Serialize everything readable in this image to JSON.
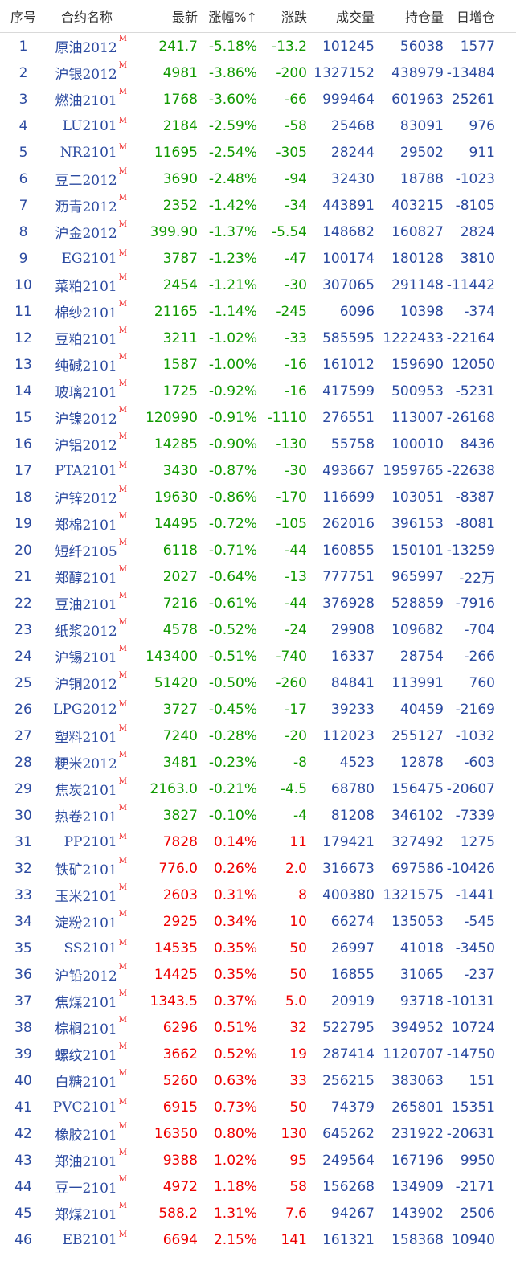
{
  "headers": [
    "序号",
    "合约名称",
    "最新",
    "涨幅%↑",
    "涨跌",
    "成交量",
    "持仓量",
    "日增仓"
  ],
  "colors": {
    "down": "#119900",
    "up": "#ee0000",
    "neutral": "#2b4aa0"
  },
  "rows": [
    {
      "no": "1",
      "name": "原油2012",
      "mark": "M",
      "last": "241.7",
      "pct": "-5.18%",
      "chg": "-13.2",
      "vol": "101245",
      "oi": "56038",
      "inc": "1577",
      "dir": "down"
    },
    {
      "no": "2",
      "name": "沪银2012",
      "mark": "M",
      "last": "4981",
      "pct": "-3.86%",
      "chg": "-200",
      "vol": "1327152",
      "oi": "438979",
      "inc": "-13484",
      "dir": "down"
    },
    {
      "no": "3",
      "name": "燃油2101",
      "mark": "M",
      "last": "1768",
      "pct": "-3.60%",
      "chg": "-66",
      "vol": "999464",
      "oi": "601963",
      "inc": "25261",
      "dir": "down"
    },
    {
      "no": "4",
      "name": "LU2101",
      "mark": "M",
      "last": "2184",
      "pct": "-2.59%",
      "chg": "-58",
      "vol": "25468",
      "oi": "83091",
      "inc": "976",
      "dir": "down"
    },
    {
      "no": "5",
      "name": "NR2101",
      "mark": "M",
      "last": "11695",
      "pct": "-2.54%",
      "chg": "-305",
      "vol": "28244",
      "oi": "29502",
      "inc": "911",
      "dir": "down"
    },
    {
      "no": "6",
      "name": "豆二2012",
      "mark": "M",
      "last": "3690",
      "pct": "-2.48%",
      "chg": "-94",
      "vol": "32430",
      "oi": "18788",
      "inc": "-1023",
      "dir": "down"
    },
    {
      "no": "7",
      "name": "沥青2012",
      "mark": "M",
      "last": "2352",
      "pct": "-1.42%",
      "chg": "-34",
      "vol": "443891",
      "oi": "403215",
      "inc": "-8105",
      "dir": "down"
    },
    {
      "no": "8",
      "name": "沪金2012",
      "mark": "M",
      "last": "399.90",
      "pct": "-1.37%",
      "chg": "-5.54",
      "vol": "148682",
      "oi": "160827",
      "inc": "2824",
      "dir": "down"
    },
    {
      "no": "9",
      "name": "EG2101",
      "mark": "M",
      "last": "3787",
      "pct": "-1.23%",
      "chg": "-47",
      "vol": "100174",
      "oi": "180128",
      "inc": "3810",
      "dir": "down"
    },
    {
      "no": "10",
      "name": "菜粕2101",
      "mark": "M",
      "last": "2454",
      "pct": "-1.21%",
      "chg": "-30",
      "vol": "307065",
      "oi": "291148",
      "inc": "-11442",
      "dir": "down"
    },
    {
      "no": "11",
      "name": "棉纱2101",
      "mark": "M",
      "last": "21165",
      "pct": "-1.14%",
      "chg": "-245",
      "vol": "6096",
      "oi": "10398",
      "inc": "-374",
      "dir": "down"
    },
    {
      "no": "12",
      "name": "豆粕2101",
      "mark": "M",
      "last": "3211",
      "pct": "-1.02%",
      "chg": "-33",
      "vol": "585595",
      "oi": "1222433",
      "inc": "-22164",
      "dir": "down"
    },
    {
      "no": "13",
      "name": "纯碱2101",
      "mark": "M",
      "last": "1587",
      "pct": "-1.00%",
      "chg": "-16",
      "vol": "161012",
      "oi": "159690",
      "inc": "12050",
      "dir": "down"
    },
    {
      "no": "14",
      "name": "玻璃2101",
      "mark": "M",
      "last": "1725",
      "pct": "-0.92%",
      "chg": "-16",
      "vol": "417599",
      "oi": "500953",
      "inc": "-5231",
      "dir": "down"
    },
    {
      "no": "15",
      "name": "沪镍2012",
      "mark": "M",
      "last": "120990",
      "pct": "-0.91%",
      "chg": "-1110",
      "vol": "276551",
      "oi": "113007",
      "inc": "-26168",
      "dir": "down"
    },
    {
      "no": "16",
      "name": "沪铝2012",
      "mark": "M",
      "last": "14285",
      "pct": "-0.90%",
      "chg": "-130",
      "vol": "55758",
      "oi": "100010",
      "inc": "8436",
      "dir": "down"
    },
    {
      "no": "17",
      "name": "PTA2101",
      "mark": "M",
      "last": "3430",
      "pct": "-0.87%",
      "chg": "-30",
      "vol": "493667",
      "oi": "1959765",
      "inc": "-22638",
      "dir": "down"
    },
    {
      "no": "18",
      "name": "沪锌2012",
      "mark": "M",
      "last": "19630",
      "pct": "-0.86%",
      "chg": "-170",
      "vol": "116699",
      "oi": "103051",
      "inc": "-8387",
      "dir": "down"
    },
    {
      "no": "19",
      "name": "郑棉2101",
      "mark": "M",
      "last": "14495",
      "pct": "-0.72%",
      "chg": "-105",
      "vol": "262016",
      "oi": "396153",
      "inc": "-8081",
      "dir": "down"
    },
    {
      "no": "20",
      "name": "短纤2105",
      "mark": "M",
      "last": "6118",
      "pct": "-0.71%",
      "chg": "-44",
      "vol": "160855",
      "oi": "150101",
      "inc": "-13259",
      "dir": "down"
    },
    {
      "no": "21",
      "name": "郑醇2101",
      "mark": "M",
      "last": "2027",
      "pct": "-0.64%",
      "chg": "-13",
      "vol": "777751",
      "oi": "965997",
      "inc": "-22万",
      "dir": "down"
    },
    {
      "no": "22",
      "name": "豆油2101",
      "mark": "M",
      "last": "7216",
      "pct": "-0.61%",
      "chg": "-44",
      "vol": "376928",
      "oi": "528859",
      "inc": "-7916",
      "dir": "down"
    },
    {
      "no": "23",
      "name": "纸浆2012",
      "mark": "M",
      "last": "4578",
      "pct": "-0.52%",
      "chg": "-24",
      "vol": "29908",
      "oi": "109682",
      "inc": "-704",
      "dir": "down"
    },
    {
      "no": "24",
      "name": "沪锡2101",
      "mark": "M",
      "last": "143400",
      "pct": "-0.51%",
      "chg": "-740",
      "vol": "16337",
      "oi": "28754",
      "inc": "-266",
      "dir": "down"
    },
    {
      "no": "25",
      "name": "沪铜2012",
      "mark": "M",
      "last": "51420",
      "pct": "-0.50%",
      "chg": "-260",
      "vol": "84841",
      "oi": "113991",
      "inc": "760",
      "dir": "down"
    },
    {
      "no": "26",
      "name": "LPG2012",
      "mark": "M",
      "last": "3727",
      "pct": "-0.45%",
      "chg": "-17",
      "vol": "39233",
      "oi": "40459",
      "inc": "-2169",
      "dir": "down"
    },
    {
      "no": "27",
      "name": "塑料2101",
      "mark": "M",
      "last": "7240",
      "pct": "-0.28%",
      "chg": "-20",
      "vol": "112023",
      "oi": "255127",
      "inc": "-1032",
      "dir": "down"
    },
    {
      "no": "28",
      "name": "粳米2012",
      "mark": "M",
      "last": "3481",
      "pct": "-0.23%",
      "chg": "-8",
      "vol": "4523",
      "oi": "12878",
      "inc": "-603",
      "dir": "down"
    },
    {
      "no": "29",
      "name": "焦炭2101",
      "mark": "M",
      "last": "2163.0",
      "pct": "-0.21%",
      "chg": "-4.5",
      "vol": "68780",
      "oi": "156475",
      "inc": "-20607",
      "dir": "down"
    },
    {
      "no": "30",
      "name": "热卷2101",
      "mark": "M",
      "last": "3827",
      "pct": "-0.10%",
      "chg": "-4",
      "vol": "81208",
      "oi": "346102",
      "inc": "-7339",
      "dir": "down"
    },
    {
      "no": "31",
      "name": "PP2101",
      "mark": "M",
      "last": "7828",
      "pct": "0.14%",
      "chg": "11",
      "vol": "179421",
      "oi": "327492",
      "inc": "1275",
      "dir": "up"
    },
    {
      "no": "32",
      "name": "铁矿2101",
      "mark": "M",
      "last": "776.0",
      "pct": "0.26%",
      "chg": "2.0",
      "vol": "316673",
      "oi": "697586",
      "inc": "-10426",
      "dir": "up"
    },
    {
      "no": "33",
      "name": "玉米2101",
      "mark": "M",
      "last": "2603",
      "pct": "0.31%",
      "chg": "8",
      "vol": "400380",
      "oi": "1321575",
      "inc": "-1441",
      "dir": "up"
    },
    {
      "no": "34",
      "name": "淀粉2101",
      "mark": "M",
      "last": "2925",
      "pct": "0.34%",
      "chg": "10",
      "vol": "66274",
      "oi": "135053",
      "inc": "-545",
      "dir": "up"
    },
    {
      "no": "35",
      "name": "SS2101",
      "mark": "M",
      "last": "14535",
      "pct": "0.35%",
      "chg": "50",
      "vol": "26997",
      "oi": "41018",
      "inc": "-3450",
      "dir": "up"
    },
    {
      "no": "36",
      "name": "沪铅2012",
      "mark": "M",
      "last": "14425",
      "pct": "0.35%",
      "chg": "50",
      "vol": "16855",
      "oi": "31065",
      "inc": "-237",
      "dir": "up"
    },
    {
      "no": "37",
      "name": "焦煤2101",
      "mark": "M",
      "last": "1343.5",
      "pct": "0.37%",
      "chg": "5.0",
      "vol": "20919",
      "oi": "93718",
      "inc": "-10131",
      "dir": "up"
    },
    {
      "no": "38",
      "name": "棕榈2101",
      "mark": "M",
      "last": "6296",
      "pct": "0.51%",
      "chg": "32",
      "vol": "522795",
      "oi": "394952",
      "inc": "10724",
      "dir": "up"
    },
    {
      "no": "39",
      "name": "螺纹2101",
      "mark": "M",
      "last": "3662",
      "pct": "0.52%",
      "chg": "19",
      "vol": "287414",
      "oi": "1120707",
      "inc": "-14750",
      "dir": "up"
    },
    {
      "no": "40",
      "name": "白糖2101",
      "mark": "M",
      "last": "5260",
      "pct": "0.63%",
      "chg": "33",
      "vol": "256215",
      "oi": "383063",
      "inc": "151",
      "dir": "up"
    },
    {
      "no": "41",
      "name": "PVC2101",
      "mark": "M",
      "last": "6915",
      "pct": "0.73%",
      "chg": "50",
      "vol": "74379",
      "oi": "265801",
      "inc": "15351",
      "dir": "up"
    },
    {
      "no": "42",
      "name": "橡胶2101",
      "mark": "M",
      "last": "16350",
      "pct": "0.80%",
      "chg": "130",
      "vol": "645262",
      "oi": "231922",
      "inc": "-20631",
      "dir": "up"
    },
    {
      "no": "43",
      "name": "郑油2101",
      "mark": "M",
      "last": "9388",
      "pct": "1.02%",
      "chg": "95",
      "vol": "249564",
      "oi": "167196",
      "inc": "9950",
      "dir": "up"
    },
    {
      "no": "44",
      "name": "豆一2101",
      "mark": "M",
      "last": "4972",
      "pct": "1.18%",
      "chg": "58",
      "vol": "156268",
      "oi": "134909",
      "inc": "-2171",
      "dir": "up"
    },
    {
      "no": "45",
      "name": "郑煤2101",
      "mark": "M",
      "last": "588.2",
      "pct": "1.31%",
      "chg": "7.6",
      "vol": "94267",
      "oi": "143902",
      "inc": "2506",
      "dir": "up"
    },
    {
      "no": "46",
      "name": "EB2101",
      "mark": "M",
      "last": "6694",
      "pct": "2.15%",
      "chg": "141",
      "vol": "161321",
      "oi": "158368",
      "inc": "10940",
      "dir": "up"
    }
  ]
}
